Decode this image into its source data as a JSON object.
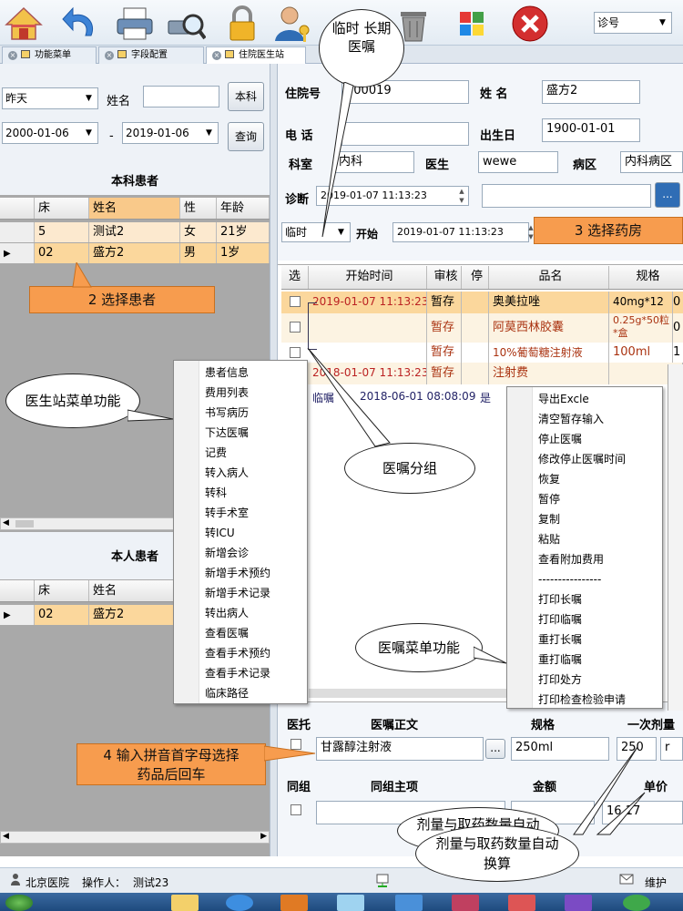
{
  "toolbar": {
    "icons": [
      "home-icon",
      "undo-icon",
      "printer-icon",
      "print-preview-icon",
      "lock-icon",
      "user-key-icon",
      "trash-icon",
      "tiles-icon",
      "close-icon"
    ],
    "query_type": "诊号"
  },
  "tabs": [
    {
      "label": "功能菜单"
    },
    {
      "label": "字段配置"
    },
    {
      "label": "住院医生站"
    }
  ],
  "left": {
    "date_range": "昨天",
    "name_label": "姓名",
    "dept_button": "本科",
    "date_from": "2000-01-06",
    "date_to": "2019-01-06",
    "query_button": "查询",
    "dept_patients_title": "本科患者",
    "headers": [
      "床",
      "姓名",
      "性",
      "年龄"
    ],
    "rows": [
      {
        "bed": "5",
        "name": "测试2",
        "sex": "女",
        "age": "21岁"
      },
      {
        "bed": "02",
        "name": "盛方2",
        "sex": "男",
        "age": "1岁"
      }
    ],
    "my_patients_title": "本人患者",
    "my_headers": [
      "床",
      "姓名"
    ],
    "my_rows": [
      {
        "bed": "02",
        "name": "盛方2"
      }
    ]
  },
  "patient": {
    "admission_label": "住院号",
    "admission_no": "000019",
    "name_label": "姓 名",
    "name": "盛方2",
    "phone_label": "电 话",
    "phone": "",
    "dob_label": "出生日",
    "dob": "1900-01-01",
    "dept_label": "科室",
    "dept": "内科",
    "doctor_label": "医生",
    "doctor": "wewe",
    "ward_label": "病区",
    "ward": "内科病区",
    "diagnosis_label": "诊断",
    "diagnosis_time": "2019-01-07 11:13:23",
    "order_type": "临时",
    "start_label": "开始",
    "start_time": "2019-01-07 11:13:23"
  },
  "orders": {
    "headers": [
      "选",
      "开始时间",
      "审核",
      "停",
      "品名",
      "规格"
    ],
    "rows": [
      {
        "time": "2019-01-07 11:13:23",
        "status": "暂存",
        "name": "奥美拉唑",
        "spec": "40mg*12",
        "extra": "0"
      },
      {
        "time": "",
        "status": "暂存",
        "name": "阿莫西林胶囊",
        "spec": "0.25g*50粒*盒",
        "extra": "0"
      },
      {
        "time": "",
        "status": "暂存",
        "name": "10%葡萄糖注射液",
        "spec": "100ml",
        "extra": "1"
      },
      {
        "time": "2018-01-07 11:13:23",
        "status": "暂存",
        "name": "注射费",
        "spec": "",
        "extra": ""
      }
    ],
    "group_row": {
      "type": "临嘱",
      "time": "2018-06-01 08:08:09",
      "flag": "是"
    }
  },
  "doctor_menu": [
    "患者信息",
    "费用列表",
    "书写病历",
    "下达医嘱",
    "记费",
    "转入病人",
    "转科",
    "转手术室",
    "转ICU",
    "新增会诊",
    "新增手术预约",
    "新增手术记录",
    "转出病人",
    "查看医嘱",
    "查看手术预约",
    "查看手术记录",
    "临床路径"
  ],
  "order_menu": [
    "导出Excle",
    "清空暂存输入",
    "停止医嘱",
    "修改停止医嘱时间",
    "恢复",
    "暂停",
    "复制",
    "粘贴",
    "查看附加费用",
    "----------------",
    "打印长嘱",
    "打印临嘱",
    "重打长嘱",
    "重打临嘱",
    "打印处方",
    "打印检查检验申请"
  ],
  "entry": {
    "yituo_label": "医托",
    "text_label": "医嘱正文",
    "spec_label": "规格",
    "dose_label": "一次剂量",
    "drug": "甘露醇注射液",
    "spec": "250ml",
    "dose": "250",
    "dose_unit": "r",
    "group_label": "同组",
    "group_main_label": "同组主项",
    "amount_label": "金额",
    "price_label": "单价",
    "price": "16.17"
  },
  "annotations": {
    "order_type": "临时 长期\n医嘱",
    "choose_patient": "2 选择患者",
    "choose_pharmacy": "3 选择药房",
    "doctor_menu": "医生站菜单功能",
    "order_group": "医嘱分组",
    "order_menu": "医嘱菜单功能",
    "input_pinyin": "4 输入拼音首字母选择\n药品后回车",
    "auto_calc_back": "剂量与取药数量自动",
    "auto_calc": "剂量与取药数量自动\n换算"
  },
  "status": {
    "hospital": "北京医院",
    "operator_label": "操作人：",
    "operator": "测试23",
    "maintain": "维护"
  },
  "colors": {
    "accent_orange": "#f79c4e",
    "selected_row": "#fbd79c",
    "header_orange": "#f9c98a",
    "grid_bg": "#a9a9a9"
  }
}
